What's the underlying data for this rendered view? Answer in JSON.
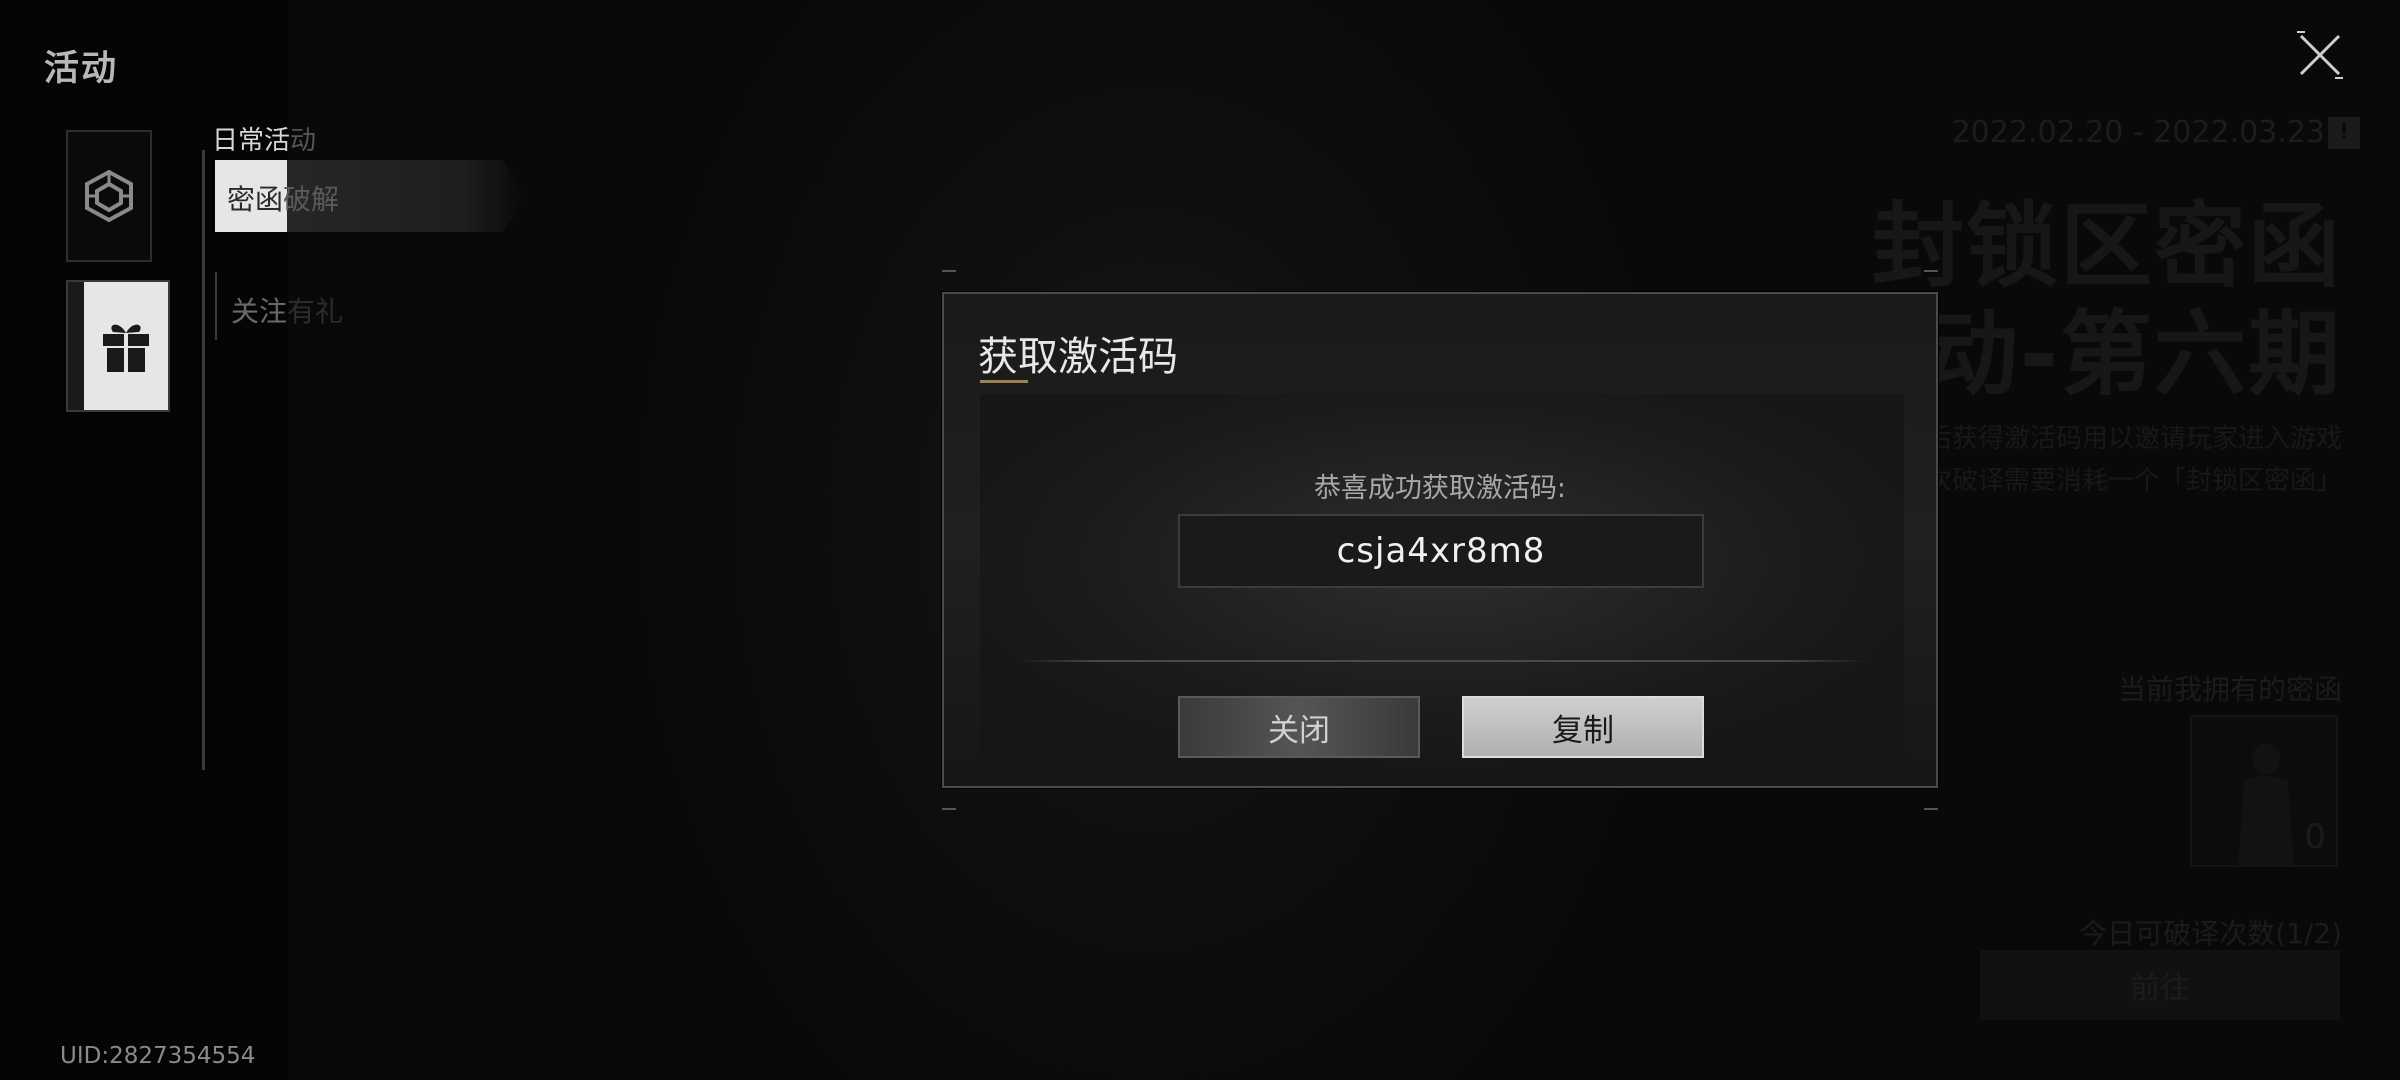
{
  "sidebar": {
    "title": "活动",
    "uid": "UID:2827354554"
  },
  "menu": {
    "section_label": "日常活",
    "section_label_faded": "动",
    "active_item_prefix": "密函",
    "active_item_suffix": "破解",
    "item_2_visible": "关注",
    "item_2_faded": "有礼"
  },
  "event": {
    "date_range": "2022.02.20 - 2022.03.23",
    "info_badge": "!",
    "title_line1": "封锁区密函",
    "title_line2": "破译活动-第六期",
    "desc_line1": "密函破译成功后获得激活码用以邀请玩家进入游戏",
    "desc_line2": "每次破译需要消耗一个「封锁区密函」",
    "owned_label": "当前我拥有的密函",
    "owned_count": "0",
    "attempts_label": "今日可破译次数(1/2)",
    "go_button": "前往"
  },
  "modal": {
    "title": "获取激活码",
    "success_label": "恭喜成功获取激活码:",
    "code": "csja4xr8m8",
    "close_button": "关闭",
    "copy_button": "复制"
  },
  "colors": {
    "accent_underline": "#9c8448",
    "copy_button_bg": "#c4c4c4"
  }
}
